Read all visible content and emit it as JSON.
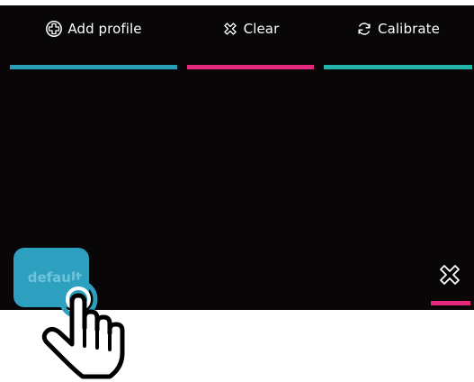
{
  "toolbar": {
    "add_profile": {
      "label": "Add profile",
      "icon": "plus-circle-icon",
      "accent": "#2aa0b8"
    },
    "clear": {
      "label": "Clear",
      "icon": "x-outline-icon",
      "accent": "#e52a7d"
    },
    "calibrate": {
      "label": "Calibrate",
      "icon": "refresh-icon",
      "accent": "#22b3a8"
    }
  },
  "profiles": [
    {
      "label": "default",
      "color": "#2da0bf"
    }
  ],
  "delete": {
    "icon": "x-outline-icon",
    "accent": "#e52a7d"
  },
  "cursor": {
    "icon": "pointing-hand-cursor"
  },
  "colors": {
    "background": "#080606",
    "text": "#ffffff"
  }
}
